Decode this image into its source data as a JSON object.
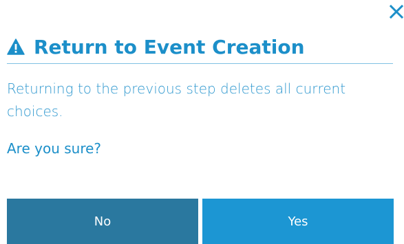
{
  "dialog": {
    "title": "Return to Event Creation",
    "message": "Returning to the previous step deletes all current choices.",
    "question": "Are you sure?",
    "close_icon": "close-icon",
    "warning_icon": "warning-triangle-icon"
  },
  "buttons": {
    "no_label": "No",
    "yes_label": "Yes"
  },
  "colors": {
    "accent": "#1c8fc9",
    "button_no": "#2a789f",
    "button_yes": "#1c96d3",
    "divider": "#7fc0e3"
  }
}
